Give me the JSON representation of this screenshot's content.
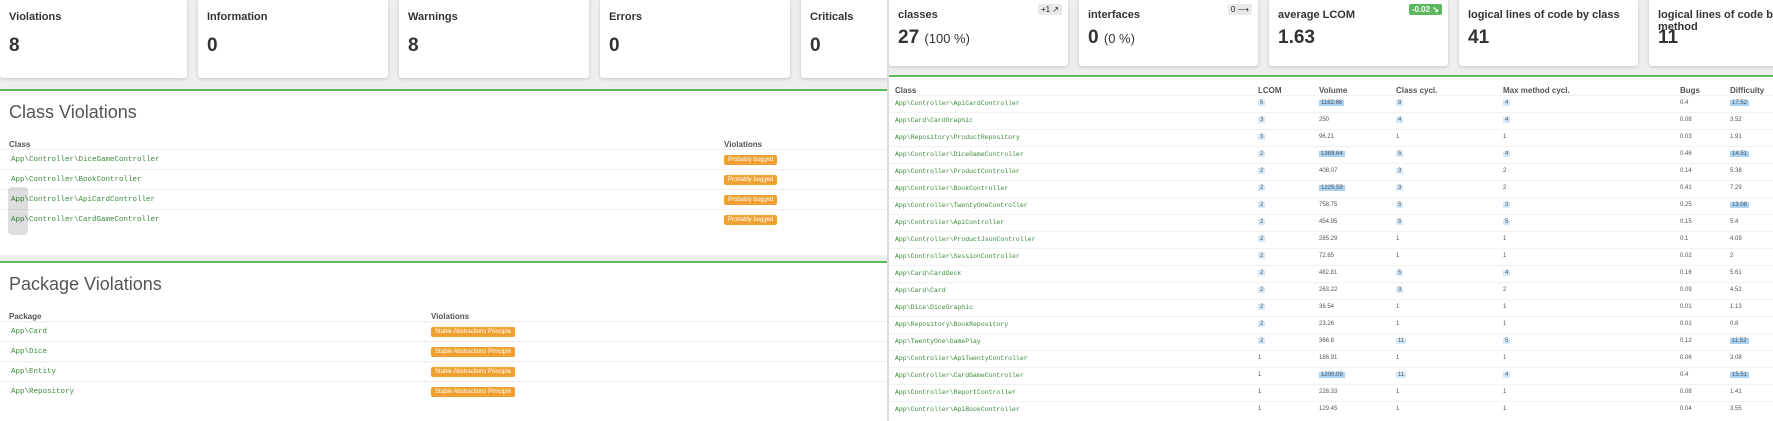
{
  "left": {
    "cards": [
      {
        "label": "Violations",
        "value": "8"
      },
      {
        "label": "Information",
        "value": "0"
      },
      {
        "label": "Warnings",
        "value": "8"
      },
      {
        "label": "Errors",
        "value": "0"
      },
      {
        "label": "Criticals",
        "value": "0"
      }
    ],
    "class_violations": {
      "title": "Class Violations",
      "col_class": "Class",
      "col_violations": "Violations",
      "rows": [
        {
          "name": "App\\Controller\\DiceGameController",
          "violation": "Probably bugged"
        },
        {
          "name": "App\\Controller\\BookController",
          "violation": "Probably bugged"
        },
        {
          "name": "App\\Controller\\ApiCardController",
          "violation": "Probably bugged"
        },
        {
          "name": "App\\Controller\\CardGameController",
          "violation": "Probably bugged"
        }
      ]
    },
    "package_violations": {
      "title": "Package Violations",
      "col_package": "Package",
      "col_violations": "Violations",
      "rows": [
        {
          "name": "App\\Card",
          "violation": "Stable Abstractions Principle"
        },
        {
          "name": "App\\Dice",
          "violation": "Stable Abstractions Principle"
        },
        {
          "name": "App\\Entity",
          "violation": "Stable Abstractions Principle"
        },
        {
          "name": "App\\Repository",
          "violation": "Stable Abstractions Principle"
        }
      ]
    }
  },
  "right": {
    "cards": [
      {
        "label": "classes",
        "value": "27",
        "sub": "(100 %)",
        "trend": "+1 ↗"
      },
      {
        "label": "interfaces",
        "value": "0",
        "sub": "(0 %)",
        "trend": "0 ⟶"
      },
      {
        "label": "average LCOM",
        "value": "1.63",
        "sub": "",
        "trend": "-0.02 ↘"
      },
      {
        "label": "logical lines of code by class",
        "value": "41",
        "sub": "",
        "trend": ""
      },
      {
        "label": "logical lines of code by method",
        "value": "11",
        "sub": "",
        "trend": ""
      }
    ],
    "headers": {
      "class": "Class",
      "lcom": "LCOM",
      "volume": "Volume",
      "classcycl": "Class cycl.",
      "maxmethod": "Max method cycl.",
      "bugs": "Bugs",
      "difficulty": "Difficulty"
    },
    "rows": [
      {
        "name": "App\\Controller\\ApiCardController",
        "lcom": "5",
        "volume": "1182.66",
        "cc": "8",
        "mm": "4",
        "bugs": "0.4",
        "diff": "17.52"
      },
      {
        "name": "App\\Card\\CardGraphic",
        "lcom": "3",
        "volume": "250",
        "cc": "4",
        "mm": "4",
        "bugs": "0.08",
        "diff": "3.52"
      },
      {
        "name": "App\\Repository\\ProductRepository",
        "lcom": "3",
        "volume": "96.21",
        "cc": "1",
        "mm": "1",
        "bugs": "0.03",
        "diff": "1.91"
      },
      {
        "name": "App\\Controller\\DiceGameController",
        "lcom": "2",
        "volume": "1389.64",
        "cc": "5",
        "mm": "4",
        "bugs": "0.46",
        "diff": "14.51"
      },
      {
        "name": "App\\Controller\\ProductController",
        "lcom": "2",
        "volume": "408.07",
        "cc": "3",
        "mm": "2",
        "bugs": "0.14",
        "diff": "5.38"
      },
      {
        "name": "App\\Controller\\BookController",
        "lcom": "2",
        "volume": "1225.59",
        "cc": "3",
        "mm": "2",
        "bugs": "0.41",
        "diff": "7.29"
      },
      {
        "name": "App\\Controller\\TwentyOneController",
        "lcom": "2",
        "volume": "758.75",
        "cc": "5",
        "mm": "3",
        "bugs": "0.25",
        "diff": "13.08"
      },
      {
        "name": "App\\Controller\\ApiController",
        "lcom": "2",
        "volume": "454.95",
        "cc": "5",
        "mm": "5",
        "bugs": "0.15",
        "diff": "5.4"
      },
      {
        "name": "App\\Controller\\ProductJsonController",
        "lcom": "2",
        "volume": "285.29",
        "cc": "1",
        "mm": "1",
        "bugs": "0.1",
        "diff": "4.09"
      },
      {
        "name": "App\\Controller\\SessionController",
        "lcom": "2",
        "volume": "72.65",
        "cc": "1",
        "mm": "1",
        "bugs": "0.02",
        "diff": "2"
      },
      {
        "name": "App\\Card\\CardDeck",
        "lcom": "2",
        "volume": "482.81",
        "cc": "5",
        "mm": "4",
        "bugs": "0.16",
        "diff": "5.61"
      },
      {
        "name": "App\\Card\\Card",
        "lcom": "2",
        "volume": "263.22",
        "cc": "3",
        "mm": "2",
        "bugs": "0.09",
        "diff": "4.52"
      },
      {
        "name": "App\\Dice\\DiceGraphic",
        "lcom": "2",
        "volume": "36.54",
        "cc": "1",
        "mm": "1",
        "bugs": "0.01",
        "diff": "1.13"
      },
      {
        "name": "App\\Repository\\BookRepository",
        "lcom": "2",
        "volume": "23.26",
        "cc": "1",
        "mm": "1",
        "bugs": "0.01",
        "diff": "0.8"
      },
      {
        "name": "App\\TwentyOne\\GamePlay",
        "lcom": "2",
        "volume": "366.8",
        "cc": "11",
        "mm": "5",
        "bugs": "0.12",
        "diff": "11.52"
      },
      {
        "name": "App\\Controller\\ApiTwentyController",
        "lcom": "1",
        "volume": "186.91",
        "cc": "1",
        "mm": "1",
        "bugs": "0.06",
        "diff": "3.08"
      },
      {
        "name": "App\\Controller\\CardGameController",
        "lcom": "1",
        "volume": "1200.09",
        "cc": "11",
        "mm": "4",
        "bugs": "0.4",
        "diff": "15.51"
      },
      {
        "name": "App\\Controller\\ReportController",
        "lcom": "1",
        "volume": "228.33",
        "cc": "1",
        "mm": "1",
        "bugs": "0.08",
        "diff": "1.41"
      },
      {
        "name": "App\\Controller\\ApiBookController",
        "lcom": "1",
        "volume": "129.45",
        "cc": "1",
        "mm": "1",
        "bugs": "0.04",
        "diff": "3.55"
      }
    ]
  }
}
